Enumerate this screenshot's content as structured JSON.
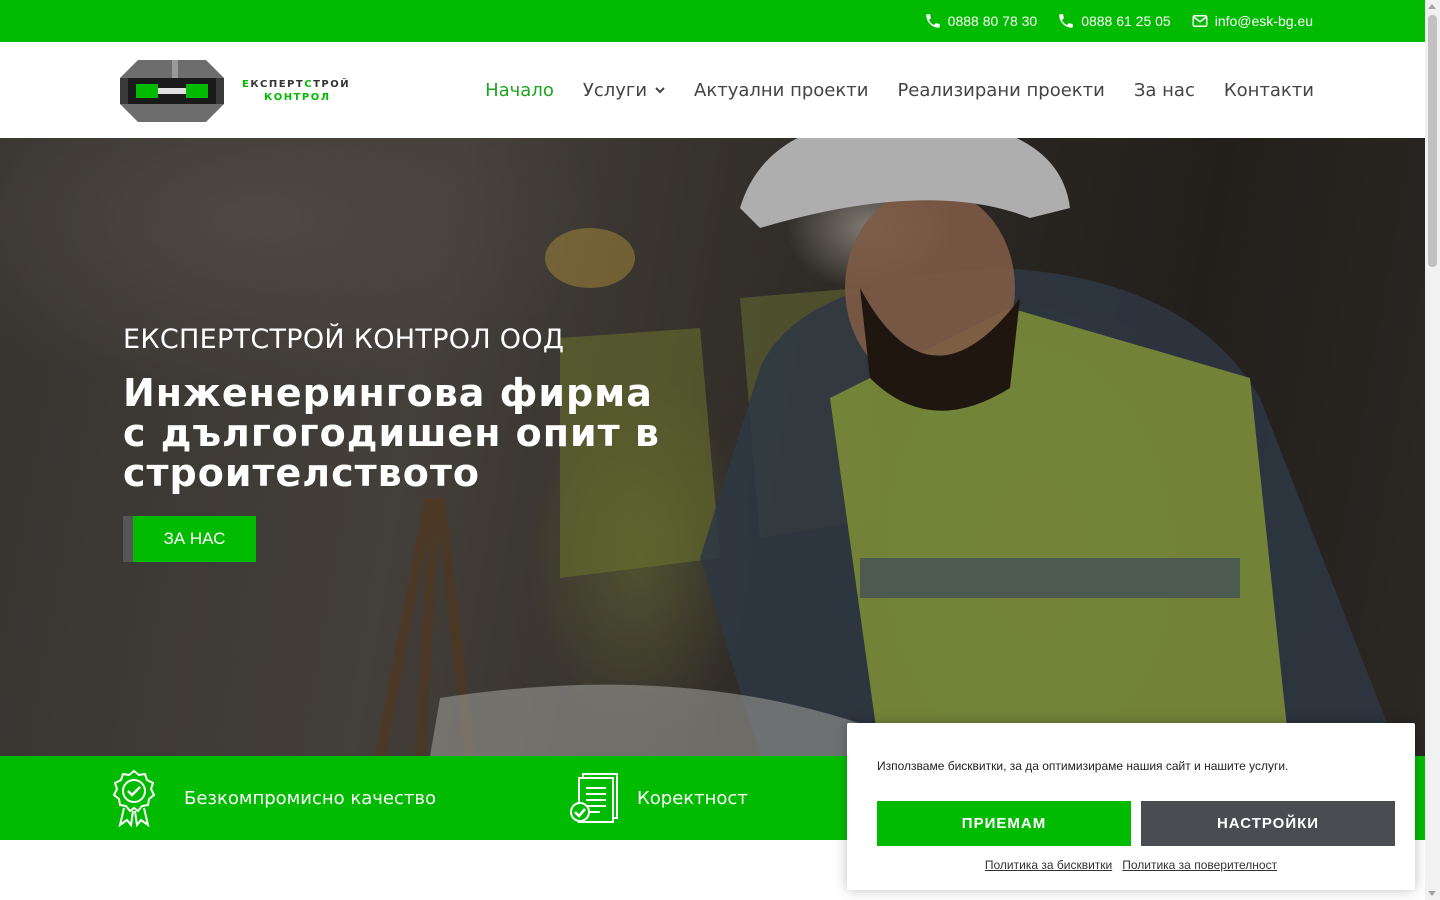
{
  "topbar": {
    "phone1": "0888 80 78 30",
    "phone2": "0888 61 25 05",
    "email": "info@esk-bg.eu",
    "phone_icon": "phone-icon",
    "email_icon": "envelope-icon"
  },
  "logo": {
    "line1_a": "Е",
    "line1_b": "КСПЕРТ",
    "line1_c": "С",
    "line1_d": "ТРОЙ",
    "line2_a": "К",
    "line2_b": "ОНТРОЛ"
  },
  "nav": {
    "items": [
      {
        "label": "Начало"
      },
      {
        "label": "Услуги"
      },
      {
        "label": "Актуални проекти"
      },
      {
        "label": "Реализирани проекти"
      },
      {
        "label": "За нас"
      },
      {
        "label": "Контакти"
      }
    ]
  },
  "hero": {
    "company": "ЕКСПЕРТСТРОЙ КОНТРОЛ ООД",
    "title_line1": "Инженерингова фирма",
    "title_line2": "с дългогодишен опит в",
    "title_line3": "строителството",
    "button_label": "ЗА НАС"
  },
  "features": [
    {
      "label": "Безкомпромисно качество",
      "icon": "award-badge-icon"
    },
    {
      "label": "Коректност",
      "icon": "document-check-icon"
    }
  ],
  "cookie": {
    "text": "Използваме бисквитки, за да оптимизираме нашия сайт и нашите услуги.",
    "accept": "ПРИЕМАМ",
    "settings": "НАСТРОЙКИ",
    "link1": "Политика за бисквитки",
    "link2": "Политика за поверителност"
  },
  "colors": {
    "brand_green": "#00bb00",
    "active_nav": "#1ea51e",
    "settings_button": "#4a4c52"
  }
}
